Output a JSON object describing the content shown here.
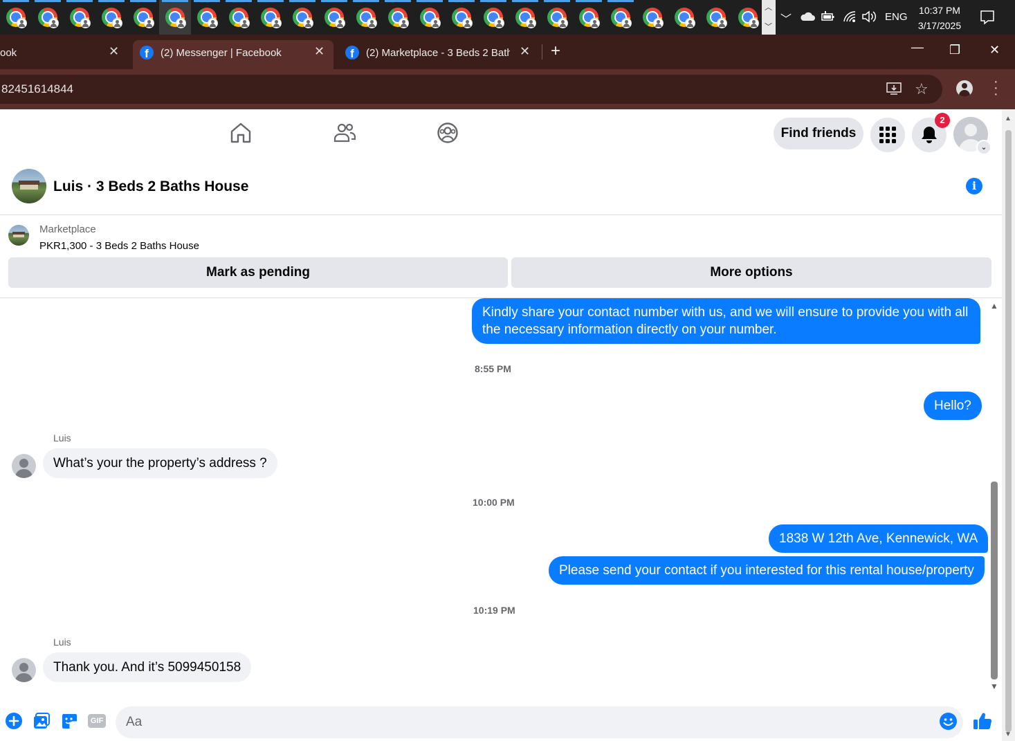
{
  "taskbar": {
    "app_icons": [
      {
        "name": "chrome"
      },
      {
        "name": "chrome"
      },
      {
        "name": "chrome"
      },
      {
        "name": "chrome"
      },
      {
        "name": "chrome"
      },
      {
        "name": "chrome",
        "active": true
      },
      {
        "name": "chrome"
      },
      {
        "name": "chrome"
      },
      {
        "name": "chrome"
      },
      {
        "name": "chrome"
      },
      {
        "name": "chrome"
      },
      {
        "name": "chrome"
      },
      {
        "name": "chrome"
      },
      {
        "name": "chrome"
      },
      {
        "name": "chrome"
      },
      {
        "name": "chrome"
      },
      {
        "name": "chrome"
      },
      {
        "name": "chrome"
      },
      {
        "name": "chrome"
      },
      {
        "name": "chrome"
      },
      {
        "name": "chrome"
      },
      {
        "name": "chrome"
      },
      {
        "name": "chrome"
      },
      {
        "name": "chrome"
      }
    ],
    "language": "ENG",
    "time": "10:37 PM",
    "date": "3/17/2025"
  },
  "browser": {
    "tabs": [
      {
        "title": "ook",
        "active": false
      },
      {
        "title": "(2) Messenger | Facebook",
        "active": true
      },
      {
        "title": "(2) Marketplace - 3 Beds 2 Bath",
        "active": false
      }
    ],
    "new_tab_label": "+",
    "url": "82451614844"
  },
  "fb_nav": {
    "find_friends_label": "Find friends",
    "notification_count": "2"
  },
  "conversation": {
    "title": "Luis · 3 Beds 2 Baths House",
    "marketplace_label": "Marketplace",
    "listing": "PKR1,300 - 3 Beds 2 Baths House",
    "mark_pending_label": "Mark as pending",
    "more_options_label": "More options"
  },
  "messages": {
    "out_1": "Kindly share your contact number with us, and we will ensure to provide you with all the necessary information directly on your number.",
    "time_1": "8:55 PM",
    "out_2": "Hello?",
    "sender_1": "Luis",
    "in_1": "What’s your the property’s address ?",
    "time_2": "10:00 PM",
    "out_3": "1838 W 12th Ave, Kennewick, WA",
    "out_4": "Please send your contact if you interested for this rental house/property",
    "time_3": "10:19 PM",
    "sender_2": "Luis",
    "in_2": "Thank you. And it’s 5099450158"
  },
  "composer": {
    "placeholder": "Aa",
    "gif_label": "GIF"
  },
  "colors": {
    "outgoing_bubble": "#0a7cff",
    "incoming_bubble": "#f0f2f5",
    "tab_strip": "#3b1d1a",
    "toolbar": "#5a2f2b",
    "badge": "#e41e3f"
  }
}
